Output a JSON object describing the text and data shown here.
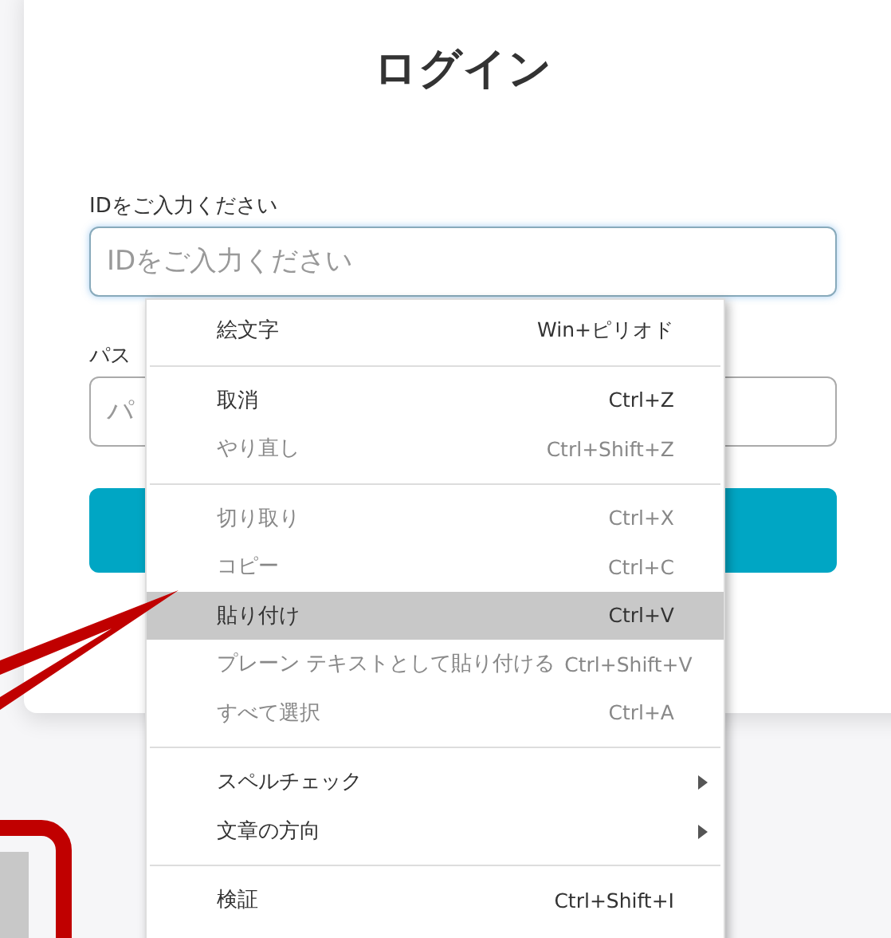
{
  "title": "ログイン",
  "fields": [
    {
      "label": "IDをご入力ください",
      "placeholder": "IDをご入力ください",
      "focused": true
    },
    {
      "label": "パス",
      "placeholder": "パ",
      "focused": false
    }
  ],
  "context_menu": {
    "groups": [
      [
        {
          "label": "絵文字",
          "shortcut": "Win+ピリオド",
          "disabled": false,
          "selected": false,
          "submenu": false
        }
      ],
      [
        {
          "label": "取消",
          "shortcut": "Ctrl+Z",
          "disabled": false,
          "selected": false,
          "submenu": false
        },
        {
          "label": "やり直し",
          "shortcut": "Ctrl+Shift+Z",
          "disabled": true,
          "selected": false,
          "submenu": false
        }
      ],
      [
        {
          "label": "切り取り",
          "shortcut": "Ctrl+X",
          "disabled": true,
          "selected": false,
          "submenu": false
        },
        {
          "label": "コピー",
          "shortcut": "Ctrl+C",
          "disabled": true,
          "selected": false,
          "submenu": false
        },
        {
          "label": "貼り付け",
          "shortcut": "Ctrl+V",
          "disabled": false,
          "selected": true,
          "submenu": false
        },
        {
          "label": "プレーン テキストとして貼り付ける",
          "shortcut": "Ctrl+Shift+V",
          "disabled": true,
          "selected": false,
          "submenu": false
        },
        {
          "label": "すべて選択",
          "shortcut": "Ctrl+A",
          "disabled": true,
          "selected": false,
          "submenu": false
        }
      ],
      [
        {
          "label": "スペルチェック",
          "disabled": false,
          "selected": false,
          "submenu": true
        },
        {
          "label": "文章の方向",
          "disabled": false,
          "selected": false,
          "submenu": true
        }
      ],
      [
        {
          "label": "検証",
          "shortcut": "Ctrl+Shift+I",
          "disabled": false,
          "selected": false,
          "submenu": false
        }
      ]
    ]
  }
}
